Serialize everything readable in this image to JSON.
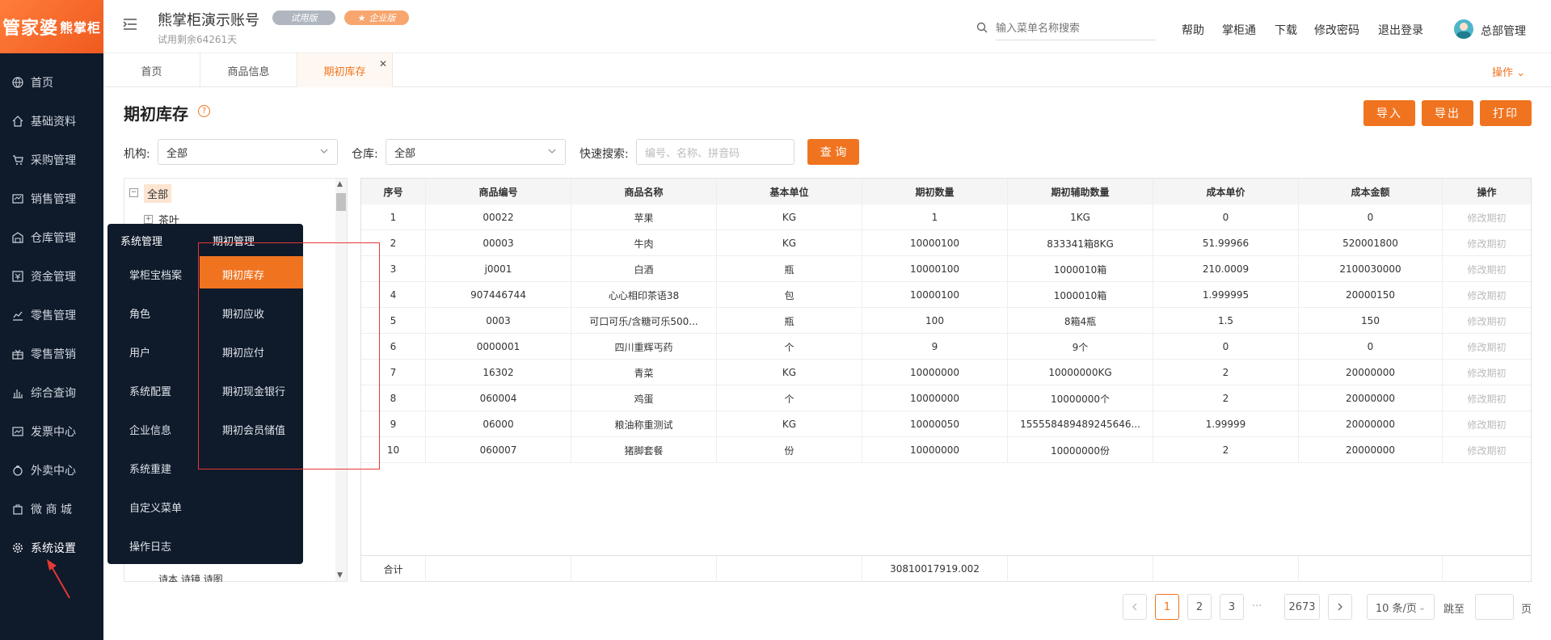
{
  "sidebar": {
    "logo_main": "管家婆",
    "logo_sub": "熊掌柜",
    "items": [
      {
        "label": "首页",
        "icon": "globe-icon"
      },
      {
        "label": "基础资料",
        "icon": "home-icon"
      },
      {
        "label": "采购管理",
        "icon": "cart-icon"
      },
      {
        "label": "销售管理",
        "icon": "sales-icon"
      },
      {
        "label": "仓库管理",
        "icon": "warehouse-icon"
      },
      {
        "label": "资金管理",
        "icon": "money-icon"
      },
      {
        "label": "零售管理",
        "icon": "chart-icon"
      },
      {
        "label": "零售营销",
        "icon": "gift-icon"
      },
      {
        "label": "综合查询",
        "icon": "bar-chart-icon"
      },
      {
        "label": "发票中心",
        "icon": "invoice-icon"
      },
      {
        "label": "外卖中心",
        "icon": "takeout-icon"
      },
      {
        "label": "微 商 城",
        "icon": "bag-icon"
      },
      {
        "label": "系统设置",
        "icon": "gear-icon"
      }
    ]
  },
  "header": {
    "account_name": "熊掌柜演示账号",
    "trial_badge": "试用版",
    "edition_badge": "企业版",
    "trial_days": "试用剩余64261天",
    "search_placeholder": "输入菜单名称搜索",
    "links": [
      "帮助",
      "掌柜通",
      "下载",
      "修改密码",
      "退出登录"
    ],
    "user_name": "总部管理"
  },
  "tabs": {
    "items": [
      "首页",
      "商品信息",
      "期初库存"
    ],
    "active": "期初库存",
    "operate": "操作"
  },
  "page": {
    "title": "期初库存",
    "help": "?",
    "buttons": [
      "导入",
      "导出",
      "打印"
    ]
  },
  "filters": {
    "org_label": "机构:",
    "org_value": "全部",
    "wh_label": "仓库:",
    "wh_value": "全部",
    "search_label": "快速搜索:",
    "search_placeholder": "编号、名称、拼音码",
    "query_btn": "查 询"
  },
  "tree": {
    "root": "全部",
    "first": "茶叶",
    "last": "诗本 诗镜 诗图"
  },
  "table": {
    "headers": [
      "序号",
      "商品编号",
      "商品名称",
      "基本单位",
      "期初数量",
      "期初辅助数量",
      "成本单价",
      "成本金额",
      "操作"
    ],
    "rows": [
      [
        "1",
        "00022",
        "苹果",
        "KG",
        "1",
        "1KG",
        "0",
        "0",
        "修改期初"
      ],
      [
        "2",
        "00003",
        "牛肉",
        "KG",
        "10000100",
        "833341箱8KG",
        "51.99966",
        "520001800",
        "修改期初"
      ],
      [
        "3",
        "j0001",
        "白酒",
        "瓶",
        "10000100",
        "1000010箱",
        "210.0009",
        "2100030000",
        "修改期初"
      ],
      [
        "4",
        "907446744",
        "心心相印茶语38",
        "包",
        "10000100",
        "1000010箱",
        "1.999995",
        "20000150",
        "修改期初"
      ],
      [
        "5",
        "0003",
        "可口可乐/含糖可乐500...",
        "瓶",
        "100",
        "8箱4瓶",
        "1.5",
        "150",
        "修改期初"
      ],
      [
        "6",
        "0000001",
        "四川重辉丐药",
        "个",
        "9",
        "9个",
        "0",
        "0",
        "修改期初"
      ],
      [
        "7",
        "16302",
        "青菜",
        "KG",
        "10000000",
        "10000000KG",
        "2",
        "20000000",
        "修改期初"
      ],
      [
        "8",
        "060004",
        "鸡蛋",
        "个",
        "10000000",
        "10000000个",
        "2",
        "20000000",
        "修改期初"
      ],
      [
        "9",
        "06000",
        "粮油称重测试",
        "KG",
        "10000050",
        "155558489489245646...",
        "1.99999",
        "20000000",
        "修改期初"
      ],
      [
        "10",
        "060007",
        "猪脚套餐",
        "份",
        "10000000",
        "10000000份",
        "2",
        "20000000",
        "修改期初"
      ]
    ],
    "total_label": "合计",
    "total_qty": "30810017919.002"
  },
  "menu_popup": {
    "col1_header": "系统管理",
    "col2_header": "期初管理",
    "col1": [
      "掌柜宝档案",
      "角色",
      "用户",
      "系统配置",
      "企业信息",
      "系统重建",
      "自定义菜单",
      "操作日志"
    ],
    "col2": [
      "期初库存",
      "期初应收",
      "期初应付",
      "期初现金银行",
      "期初会员储值"
    ],
    "active": "期初库存"
  },
  "pagination": {
    "pages": [
      "1",
      "2",
      "3"
    ],
    "ellipsis": "···",
    "last": "2673",
    "page_size": "10 条/页",
    "jump_label": "跳至",
    "page_unit": "页"
  },
  "colors": {
    "accent": "#f07420",
    "sidebar": "#0f1a2b"
  }
}
